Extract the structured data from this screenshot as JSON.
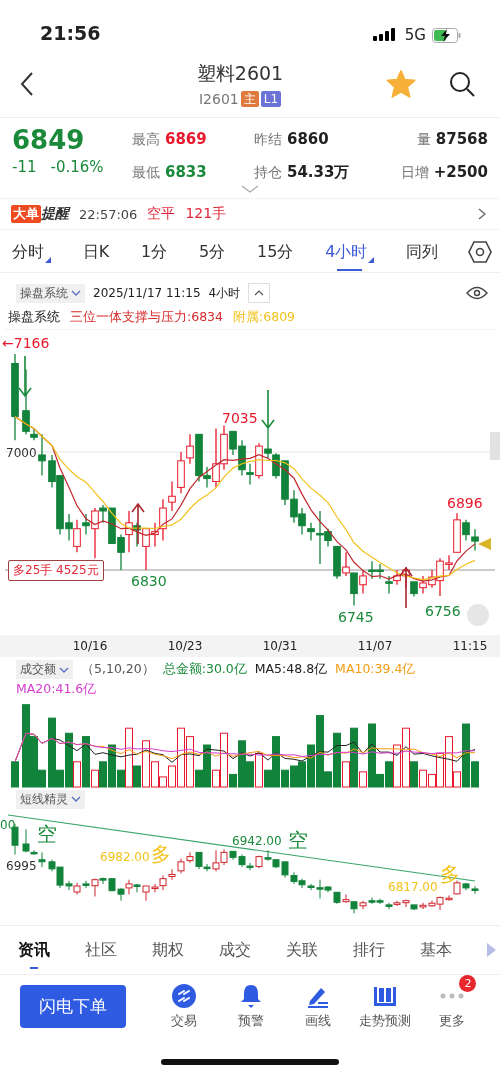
{
  "status_bar": {
    "time": "21:56",
    "network": "5G"
  },
  "header": {
    "title": "塑料2601",
    "code": "I2601",
    "favorite": true,
    "badges": [
      {
        "text": "主",
        "color": "#e07b3f"
      },
      {
        "text": "L1",
        "color": "#6b73d6"
      }
    ]
  },
  "quote": {
    "price": "6849",
    "change": "-11",
    "change_pct": "-0.16%",
    "falling": true,
    "stats": [
      {
        "label": "最高",
        "value": "6869",
        "color": "#e8192c"
      },
      {
        "label": "昨结",
        "value": "6860",
        "color": "#222222"
      },
      {
        "label": "量",
        "value": "87568",
        "color": "#222222"
      },
      {
        "label": "最低",
        "value": "6833",
        "color": "#1a8a3a"
      },
      {
        "label": "持仓",
        "value": "54.33万",
        "color": "#222222"
      },
      {
        "label": "日增",
        "value": "+2500",
        "color": "#222222"
      }
    ]
  },
  "alert": {
    "badge": "大单",
    "title": "提醒",
    "time": "22:57:06",
    "action": "空平",
    "volume": "121手"
  },
  "period_tabs": [
    {
      "label": "分时",
      "selected": false,
      "has_menu": true
    },
    {
      "label": "日K",
      "selected": false,
      "has_menu": false
    },
    {
      "label": "1分",
      "selected": false,
      "has_menu": false
    },
    {
      "label": "5分",
      "selected": false,
      "has_menu": false
    },
    {
      "label": "15分",
      "selected": false,
      "has_menu": false
    },
    {
      "label": "4小时",
      "selected": true,
      "has_menu": true
    },
    {
      "label": "同列",
      "selected": false,
      "has_menu": false
    }
  ],
  "chart_toolbar": {
    "indicator": "操盘系统",
    "datetime": "2025/11/17 11:15",
    "period": "4小时"
  },
  "legend": {
    "name": "操盘系统",
    "items": [
      {
        "text": "三位一体支撑与压力:6834",
        "color": "#d62b2b"
      },
      {
        "text": "附属:6809",
        "color": "#f2c21b"
      }
    ]
  },
  "main_chart": {
    "axis_label": "7000",
    "order_tag": "多25手 4525元",
    "price_labels": [
      {
        "text": "←7166",
        "color": "#e8192c"
      },
      {
        "text": "7035",
        "color": "#e8192c"
      },
      {
        "text": "6830",
        "color": "#1a8a3a"
      },
      {
        "text": "6896",
        "color": "#e8192c"
      },
      {
        "text": "6745",
        "color": "#1a8a3a"
      },
      {
        "text": "6756",
        "color": "#1a8a3a"
      }
    ],
    "dates": [
      "10/16",
      "10/23",
      "10/31",
      "11/07",
      "11:15"
    ]
  },
  "volume": {
    "indicator": "成交额",
    "params": "（5,10,20）",
    "items": [
      {
        "text": "总金额:30.0亿",
        "color": "#1a8a3a"
      },
      {
        "text": "MA5:48.8亿",
        "color": "#222222"
      },
      {
        "text": "MA10:39.4亿",
        "color": "#f39c12"
      },
      {
        "text": "MA20:41.6亿",
        "color": "#d63ccf"
      }
    ]
  },
  "short_chart": {
    "indicator": "短线精灵",
    "axis_label": "6995",
    "signals": [
      {
        "price": "00",
        "mark": "空",
        "kind": "short"
      },
      {
        "price": "6982.00",
        "mark": "多",
        "kind": "long"
      },
      {
        "price": "6942.00",
        "mark": "空",
        "kind": "short"
      },
      {
        "price": "6817.00",
        "mark": "多",
        "kind": "long"
      }
    ]
  },
  "bottom_tabs": [
    {
      "label": "资讯",
      "selected": true
    },
    {
      "label": "社区",
      "selected": false
    },
    {
      "label": "期权",
      "selected": false
    },
    {
      "label": "成交",
      "selected": false
    },
    {
      "label": "关联",
      "selected": false
    },
    {
      "label": "排行",
      "selected": false
    },
    {
      "label": "基本",
      "selected": false
    }
  ],
  "actions": {
    "primary": "闪电下单",
    "items": [
      {
        "label": "交易",
        "kind": "trade"
      },
      {
        "label": "预警",
        "kind": "alert"
      },
      {
        "label": "画线",
        "kind": "draw"
      },
      {
        "label": "走势预测",
        "kind": "forecast"
      },
      {
        "label": "更多",
        "kind": "more",
        "badge": "2"
      }
    ]
  }
}
